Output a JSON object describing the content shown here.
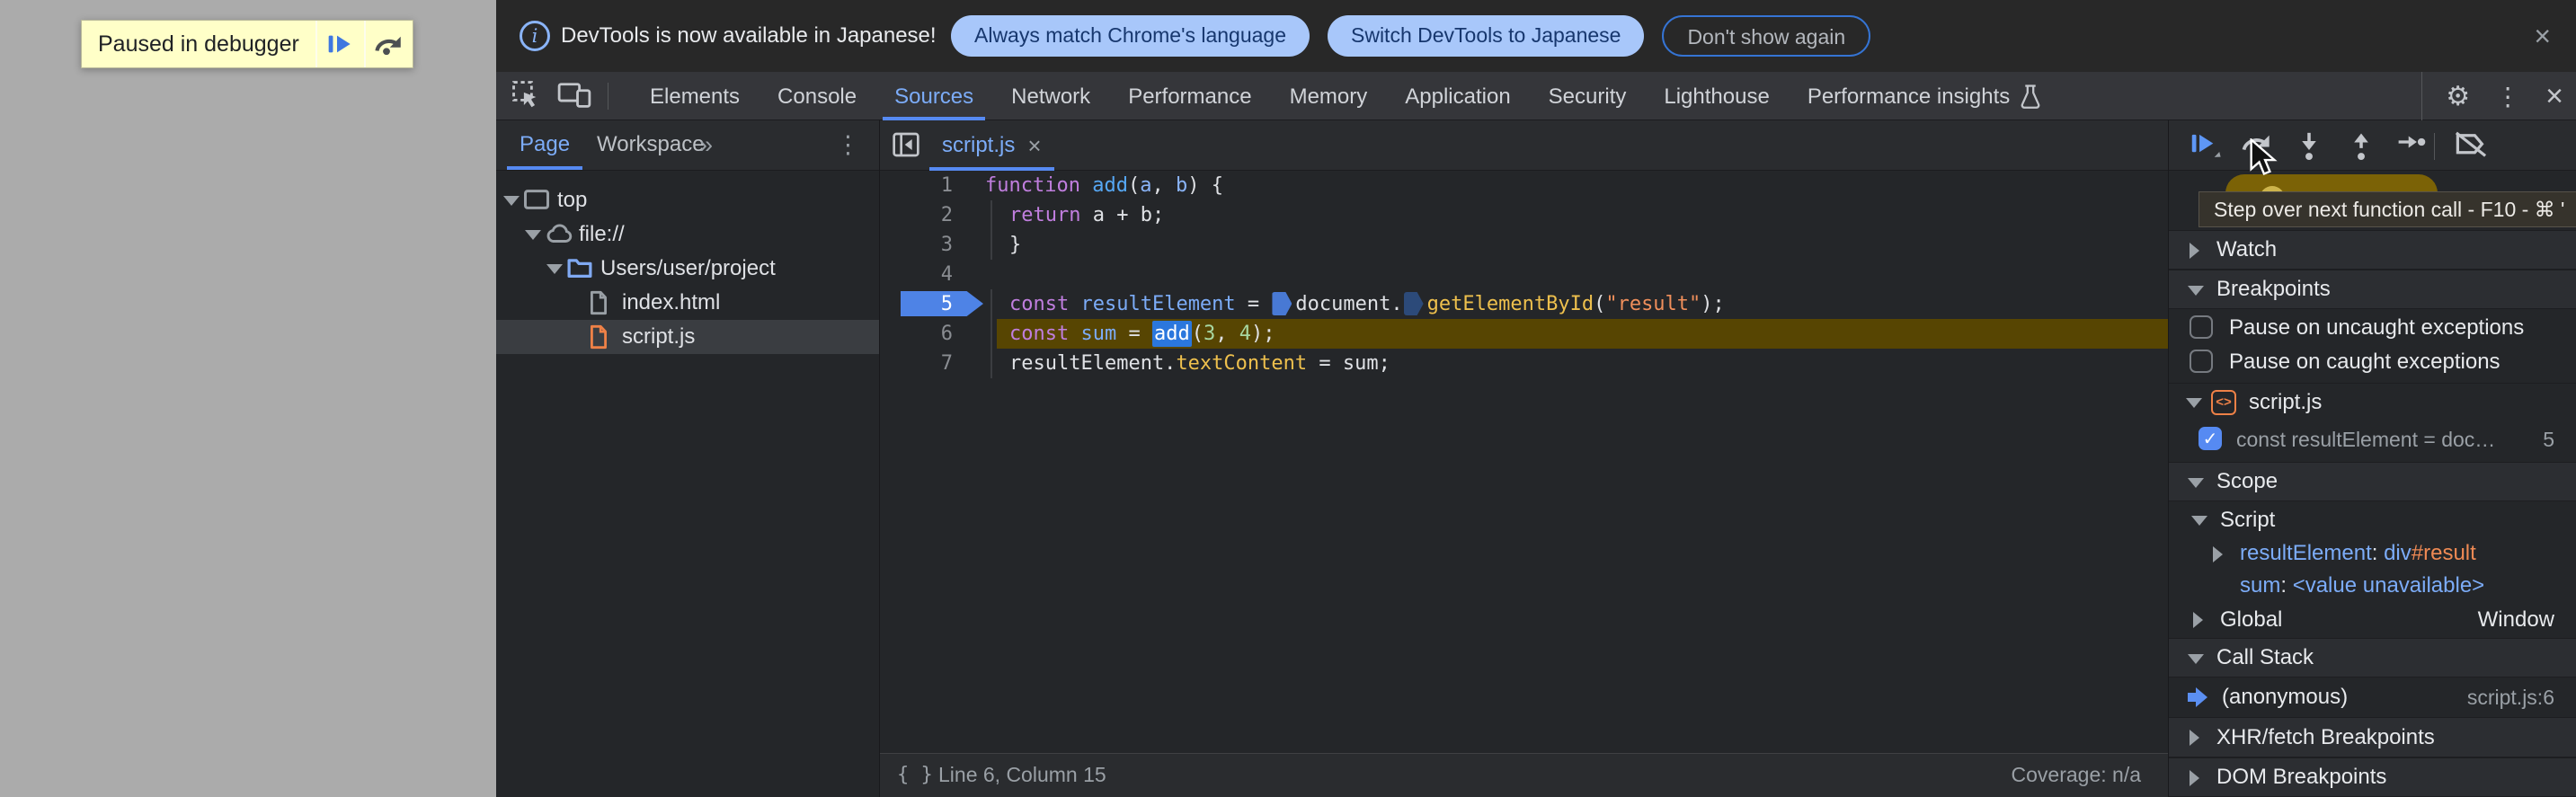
{
  "colors": {
    "accent_blue": "#568af2",
    "light_blue": "#7cacf8",
    "breakpoint_blue": "#4e83e6",
    "exec_line_bg": "#574502",
    "paused_bubble_gold": "#7b6206",
    "file_orange": "#ee8147",
    "folder_blue": "#80a9f2",
    "infobar_button_bg": "#a8c7fa",
    "infobar_button_text": "#17376e",
    "paused_overlay_bg": "#ffffc8",
    "keyword_purple": "#c07ede",
    "string_orange": "#f08f5b",
    "property_gold": "#eec04d",
    "number_green": "#a8d8a2"
  },
  "page": {
    "paused_label": "Paused in debugger"
  },
  "infobar": {
    "message": "DevTools is now available in Japanese!",
    "actions": [
      "Always match Chrome's language",
      "Switch DevTools to Japanese",
      "Don't show again"
    ],
    "close_icon": "×"
  },
  "toolbar": {
    "tabs": [
      "Elements",
      "Console",
      "Sources",
      "Network",
      "Performance",
      "Memory",
      "Application",
      "Security",
      "Lighthouse",
      "Performance insights"
    ],
    "active_tab": "Sources",
    "gear_icon": "⚙",
    "overflow_icon": "⋮",
    "close_icon": "×"
  },
  "sidebar": {
    "tabs": [
      "Page",
      "Workspace"
    ],
    "active_tab": "Page",
    "more_tabs_icon": "»",
    "menu_icon": "⋮",
    "tree": [
      {
        "label": "top",
        "icon": "frame",
        "depth": 0,
        "expanded": true
      },
      {
        "label": "file://",
        "icon": "cloud",
        "depth": 1,
        "expanded": true
      },
      {
        "label": "Users/user/project",
        "icon": "folder",
        "depth": 2,
        "expanded": true
      },
      {
        "label": "index.html",
        "icon": "file-gray",
        "depth": 3
      },
      {
        "label": "script.js",
        "icon": "file-orange",
        "depth": 3,
        "selected": true
      }
    ]
  },
  "editor": {
    "tab_label": "script.js",
    "tab_close_icon": "×",
    "format_icon": "{ }",
    "status_position": "Line 6, Column 15",
    "status_coverage": "Coverage: n/a",
    "code_lines": [
      {
        "num": 1,
        "indent": 0,
        "tokens": [
          [
            "kw",
            "function "
          ],
          [
            "fn",
            "add"
          ],
          [
            "pl",
            "("
          ],
          [
            "pm",
            "a"
          ],
          [
            "pl",
            ", "
          ],
          [
            "pm",
            "b"
          ],
          [
            "pl",
            ") {"
          ]
        ]
      },
      {
        "num": 2,
        "indent": 1,
        "tokens": [
          [
            "kw",
            "return "
          ],
          [
            "pl",
            "a + b;"
          ]
        ]
      },
      {
        "num": 3,
        "indent": 1,
        "tokens": [
          [
            "pl",
            "}"
          ]
        ]
      },
      {
        "num": 4,
        "indent": 0,
        "tokens": []
      },
      {
        "num": 5,
        "indent": 1,
        "breakpoint": true,
        "tokens": [
          [
            "kw",
            "const "
          ],
          [
            "vd",
            "resultElement"
          ],
          [
            "pl",
            " = "
          ],
          [
            "mkf",
            ""
          ],
          [
            "pl",
            "document."
          ],
          [
            "mko",
            ""
          ],
          [
            "prop",
            "getElementById"
          ],
          [
            "pl",
            "("
          ],
          [
            "str",
            "\"result\""
          ],
          [
            "pl",
            ");"
          ]
        ]
      },
      {
        "num": 6,
        "indent": 1,
        "exec": true,
        "tokens": [
          [
            "kw",
            "const "
          ],
          [
            "vd",
            "sum"
          ],
          [
            "pl",
            " = "
          ],
          [
            "call",
            "add"
          ],
          [
            "pl",
            "("
          ],
          [
            "num",
            "3"
          ],
          [
            "pl",
            ", "
          ],
          [
            "num",
            "4"
          ],
          [
            "pl",
            ");"
          ]
        ]
      },
      {
        "num": 7,
        "indent": 1,
        "tokens": [
          [
            "pl",
            "resultElement."
          ],
          [
            "prop",
            "textContent"
          ],
          [
            "pl",
            " = sum;"
          ]
        ]
      }
    ]
  },
  "debugger_panel": {
    "tooltip": "Step over next function call - F10 - ⌘ '",
    "watch_label": "Watch",
    "breakpoints_label": "Breakpoints",
    "pause_uncaught_label": "Pause on uncaught exceptions",
    "pause_caught_label": "Pause on caught exceptions",
    "breakpoint_file": "script.js",
    "breakpoint_file_icon_glyph": "<>",
    "breakpoint_item_text": "const resultElement = doc…",
    "breakpoint_item_line": "5",
    "breakpoint_item_check": "✓",
    "scope_label": "Scope",
    "scope_script_label": "Script",
    "var_separator": ": ",
    "var1_name": "resultElement",
    "var1_tag": "div",
    "var1_id": "#result",
    "var2_name": "sum",
    "var2_value": "<value unavailable>",
    "global_label": "Global",
    "global_value": "Window",
    "call_stack_label": "Call Stack",
    "frame_name": "(anonymous)",
    "frame_location": "script.js:6",
    "xhr_label": "XHR/fetch Breakpoints",
    "dom_label": "DOM Breakpoints"
  }
}
